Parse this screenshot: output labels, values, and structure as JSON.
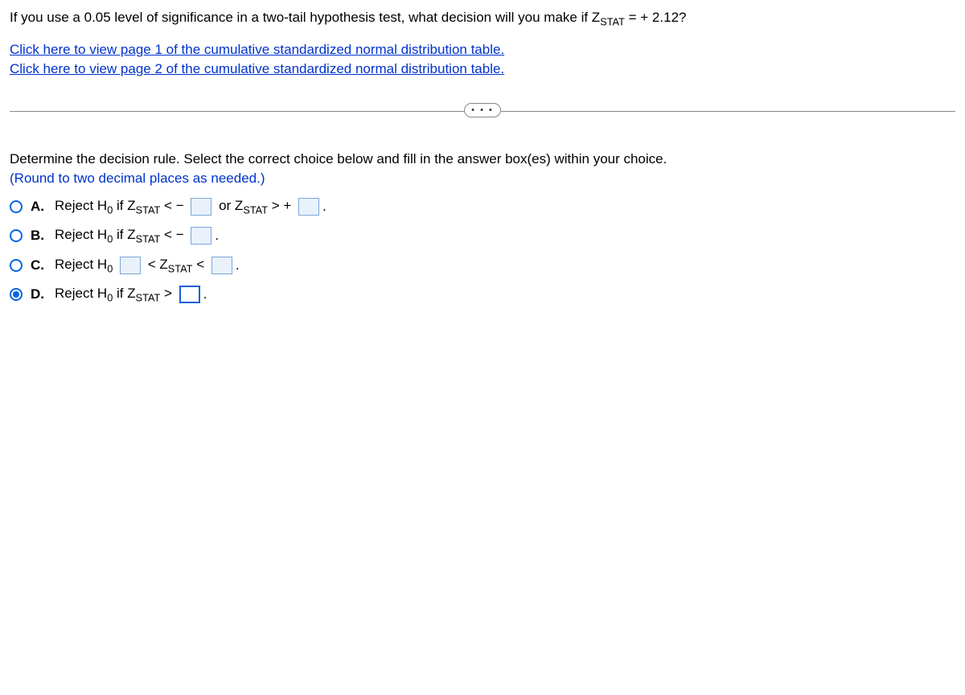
{
  "question": {
    "pre": "If you use a 0.05 level of significance in a two-tail hypothesis test, what decision will you make if Z",
    "sub": "STAT",
    "post": " = + 2.12?"
  },
  "links": {
    "page1": "Click here to view page 1 of the cumulative standardized normal distribution table.",
    "page2": "Click here to view page 2 of the cumulative standardized normal distribution table."
  },
  "divider_dots": "• • •",
  "instruction": "Determine the decision rule. Select the correct choice below and fill in the answer box(es) within your choice.",
  "round_note": "(Round to two decimal places as needed.)",
  "choices": {
    "A": {
      "letter": "A.",
      "seg1_pre": "Reject H",
      "seg1_sub": "0",
      "seg1_post": " if Z",
      "seg1_sub2": "STAT",
      "seg1_tail": " < − ",
      "seg2_pre": " or Z",
      "seg2_sub": "STAT",
      "seg2_tail": " > + ",
      "period": "."
    },
    "B": {
      "letter": "B.",
      "seg_pre": "Reject H",
      "seg_sub": "0",
      "seg_post": " if Z",
      "seg_sub2": "STAT",
      "seg_tail": " < − ",
      "period": "."
    },
    "C": {
      "letter": "C.",
      "seg_pre": "Reject H",
      "seg_sub": "0",
      "seg_post": " ",
      "seg_mid": " < Z",
      "seg_mid_sub": "STAT",
      "seg_mid_tail": " < ",
      "period": "."
    },
    "D": {
      "letter": "D.",
      "seg_pre": "Reject H",
      "seg_sub": "0",
      "seg_post": " if Z",
      "seg_sub2": "STAT",
      "seg_tail": " > ",
      "period": "."
    }
  },
  "selected": "D"
}
